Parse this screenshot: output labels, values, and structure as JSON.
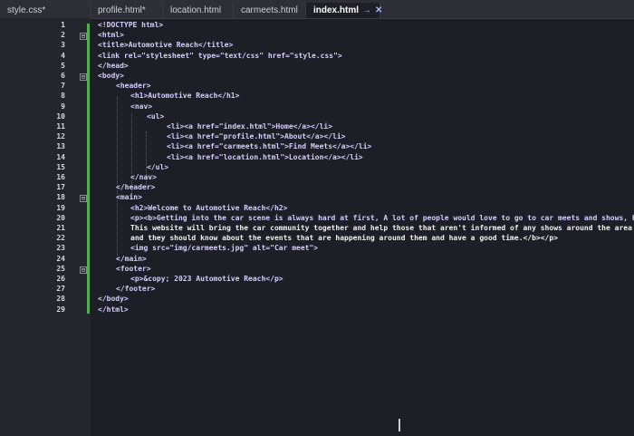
{
  "tabs": [
    {
      "label": "style.css*"
    },
    {
      "label": "profile.html*"
    },
    {
      "label": "location.html"
    },
    {
      "label": "carmeets.html"
    },
    {
      "label": "index.html",
      "active": true
    }
  ],
  "editor": {
    "line_numbers": [
      "1",
      "2",
      "3",
      "4",
      "5",
      "6",
      "7",
      "8",
      "9",
      "10",
      "11",
      "12",
      "13",
      "14",
      "15",
      "16",
      "17",
      "18",
      "19",
      "20",
      "21",
      "22",
      "23",
      "24",
      "25",
      "26",
      "27",
      "28",
      "29"
    ],
    "lines": [
      "<!DOCTYPE html>",
      "<html>",
      "<title>Automotive Reach</title>",
      "<link rel=\"stylesheet\" type=\"text/css\" href=\"style.css\">",
      "</head>",
      "<body>",
      "<header>",
      "<h1>Automotive Reach</h1>",
      "<nav>",
      "<ul>",
      "<li><a href=\"index.html\">Home</a></li>",
      "<li><a href=\"profile.html\">About</a></li>",
      "<li><a href=\"carmeets.html\">Find Meets</a></li>",
      "<li><a href=\"location.html\">Location</a></li>",
      "</ul>",
      "</nav>",
      "</header>",
      "<main>",
      "<h2>Welcome to Automotive Reach</h2>",
      "<p><b>Getting into the car scene is always hard at first, A lot of people would love to go to car meets and shows, b",
      "This website will bring the car community together and help those that aren't informed of any shows around the area",
      "and they should know about the events that are happening around them and have a good time.</b></p>",
      "<img src=\"img/carmeets.jpg\" alt=\"Car meet\">",
      "</main>",
      "<footer>",
      "<p>&copy; 2023 Automotive Reach</p>",
      "</footer>",
      "</body>",
      "</html>"
    ]
  }
}
